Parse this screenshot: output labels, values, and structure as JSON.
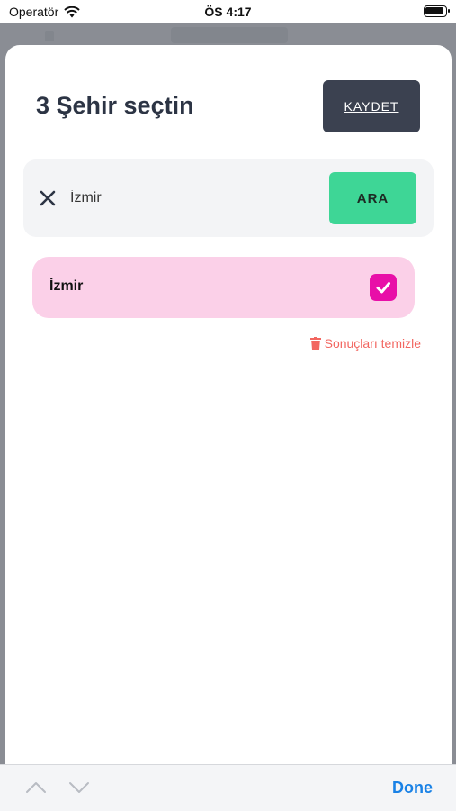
{
  "status_bar": {
    "carrier": "Operatör",
    "time": "ÖS 4:17"
  },
  "sheet": {
    "title": "3 Şehir seçtin",
    "save_label": "KAYDET"
  },
  "search": {
    "value": "İzmir",
    "button_label": "ARA"
  },
  "results": [
    {
      "label": "İzmir",
      "checked": true
    }
  ],
  "clear_results_label": "Sonuçları temizle",
  "toolbar": {
    "done_label": "Done"
  },
  "colors": {
    "save_button": "#3b4150",
    "search_button": "#3ed696",
    "result_bg": "#fbd0e8",
    "checkbox": "#e80fa8",
    "clear_link": "#f26660",
    "done": "#1a82e6"
  },
  "icons": {
    "clear": "close-icon",
    "checkbox": "checkmark-icon",
    "trash": "trash-icon",
    "prev": "chevron-up-icon",
    "next": "chevron-down-icon"
  }
}
